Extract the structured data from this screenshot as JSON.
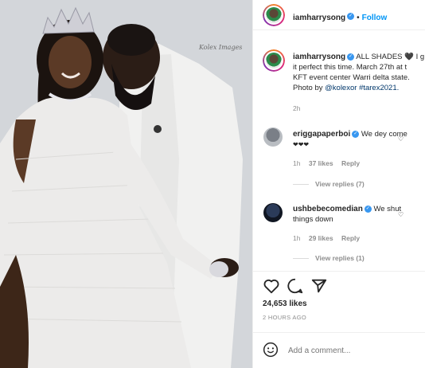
{
  "post": {
    "username": "iamharrysong",
    "follow_label": "Follow",
    "photo_signature": "Kolex Images"
  },
  "caption": {
    "username": "iamharrysong",
    "text_line1": "ALL SHADES 🖤 I g",
    "text_line2": "it perfect this time. March 27th at t",
    "text_line3": "KFT event center Warri delta state.",
    "photo_by_prefix": "Photo by ",
    "photo_by_mention": "@kolexor",
    "hashtag": "#tarex2021.",
    "time": "2h"
  },
  "comments": [
    {
      "username": "eriggapaperboi",
      "text": "We dey come",
      "text_line2": "❤❤❤",
      "time": "1h",
      "likes": "37 likes",
      "reply_label": "Reply",
      "view_replies": "View replies (7)"
    },
    {
      "username": "ushbebecomedian",
      "text": "We shut",
      "text_line2": "things down",
      "time": "1h",
      "likes": "29 likes",
      "reply_label": "Reply",
      "view_replies": "View replies (1)"
    }
  ],
  "stats": {
    "likes": "24,653 likes",
    "posted": "2 HOURS AGO"
  },
  "add_comment": {
    "placeholder": "Add a comment..."
  },
  "icons": {
    "verified": "verified-badge-icon",
    "like": "heart-icon",
    "comment": "speech-bubble-icon",
    "share": "paper-plane-icon",
    "emoji": "smiley-icon"
  },
  "colors": {
    "accent_blue": "#0095f6",
    "verified_blue": "#3897f0",
    "text": "#262626",
    "muted": "#8e8e8e"
  }
}
